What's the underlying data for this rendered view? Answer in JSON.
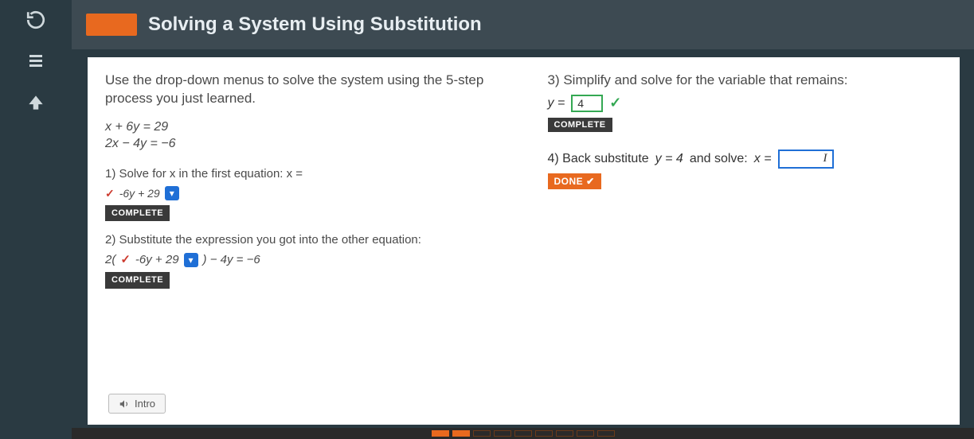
{
  "header": {
    "title": "Solving a System Using Substitution"
  },
  "left": {
    "intro1": "Use the drop-down menus to solve the system using the 5-step process you just learned.",
    "eq1": "x + 6y = 29",
    "eq2": "2x − 4y = −6",
    "step1_label": "1) Solve for x in the first equation: x =",
    "step1_answer": "-6y + 29",
    "complete1": "COMPLETE",
    "step2_label": "2) Substitute the expression you got into the other equation:",
    "step2_expr_pre": "2(",
    "step2_expr_ans": "-6y + 29",
    "step2_expr_post": ") − 4y = −6",
    "complete2": "COMPLETE"
  },
  "right": {
    "step3_label": "3) Simplify and solve for the variable that remains:",
    "step3_var": "y =",
    "step3_val": "4",
    "complete3": "COMPLETE",
    "step4_label_a": "4) Back substitute ",
    "step4_label_b": "y = 4",
    "step4_label_c": " and solve: ",
    "step4_var": "x =",
    "step4_val": "",
    "done": "DONE"
  },
  "footer": {
    "intro_btn": "Intro"
  }
}
